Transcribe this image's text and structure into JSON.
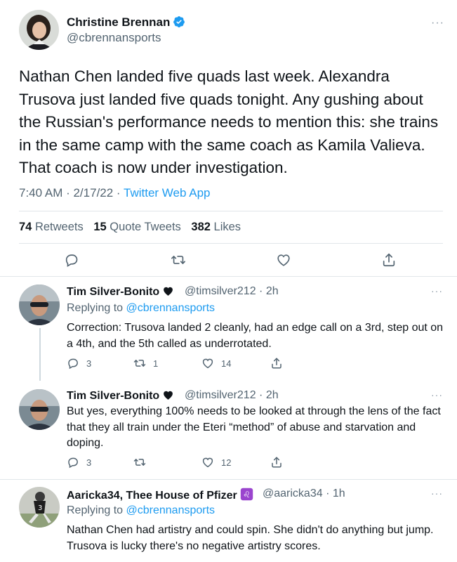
{
  "main_tweet": {
    "author": "Christine Brennan",
    "handle": "@cbrennansports",
    "text": "Nathan Chen landed five quads last week. Alexandra Trusova just landed five quads tonight. Any gushing about the Russian's performance needs to mention this: she trains in the same camp with the same coach as Kamila Valieva. That coach is now under investigation.",
    "time": "7:40 AM · 2/17/22 ·",
    "app": "Twitter Web App",
    "retweets": "74",
    "retweets_label": "Retweets",
    "quotes": "15",
    "quotes_label": "Quote Tweets",
    "likes": "382",
    "likes_label": "Likes",
    "more": "···"
  },
  "replies": [
    {
      "author": "Tim Silver-Bonito",
      "handle": "@timsilver212 · 2h",
      "replying_prefix": "Replying to",
      "replying_to": "@cbrennansports",
      "text": "Correction: Trusova landed 2 cleanly, had an edge call on a 3rd, step out on a 4th, and the 5th called as underrotated.",
      "reply_count": "3",
      "retweet_count": "1",
      "like_count": "14",
      "more": "···"
    },
    {
      "author": "Tim Silver-Bonito",
      "handle": "@timsilver212 · 2h",
      "text": "But yes, everything 100% needs to be looked at through the lens of the fact that they all train under the Eteri “method” of abuse and starvation and doping.",
      "reply_count": "3",
      "retweet_count": "",
      "like_count": "12",
      "more": "···"
    },
    {
      "author": "Aaricka34, Thee House of Pfizer",
      "handle": "@aaricka34 · 1h",
      "replying_prefix": "Replying to",
      "replying_to": "@cbrennansports",
      "text": "Nathan Chen had artistry and could spin. She didn't do anything but jump. Trusova is lucky there's no negative artistry scores.",
      "more": "···"
    }
  ],
  "colors": {
    "accent": "#1d9bf0",
    "text": "#0f1419",
    "secondary": "#536471",
    "divider": "#e1e6ea",
    "leo_badge": "#9a44ce"
  }
}
